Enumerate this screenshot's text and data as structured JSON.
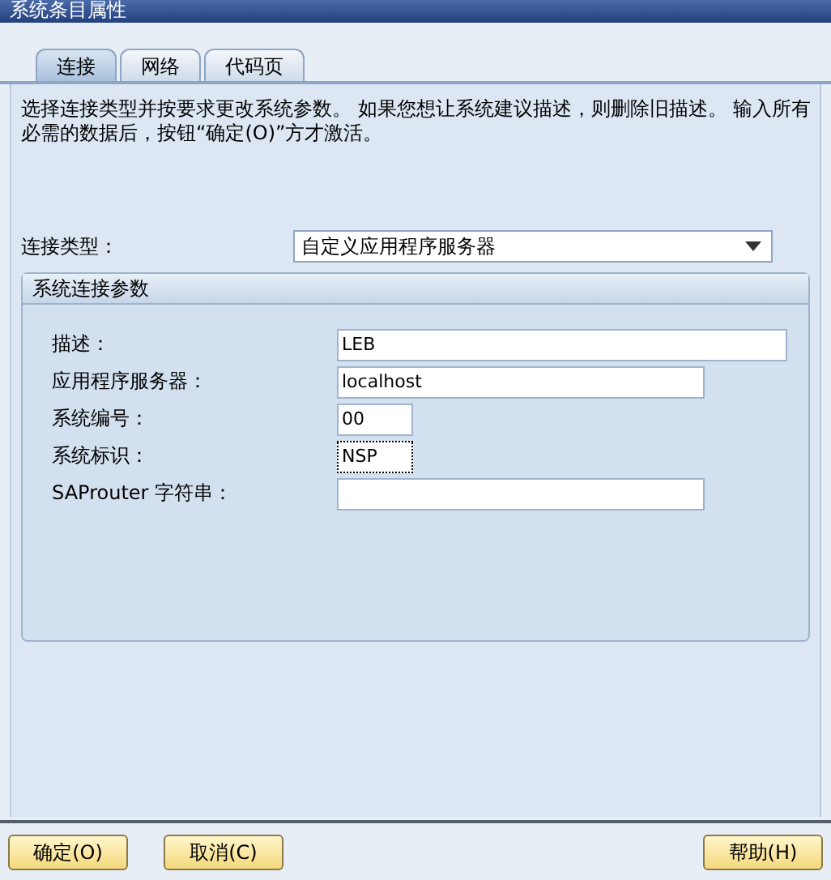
{
  "window": {
    "title": "系统条目属性"
  },
  "tabs": [
    {
      "label": "连接",
      "selected": true
    },
    {
      "label": "网络",
      "selected": false
    },
    {
      "label": "代码页",
      "selected": false
    }
  ],
  "instructions": "选择连接类型并按要求更改系统参数。 如果您想让系统建议描述，则删除旧描述。 输入所有必需的数据后，按钮“确定(O)”方才激活。",
  "connection_type": {
    "label": "连接类型：",
    "value": "自定义应用程序服务器"
  },
  "group": {
    "title": "系统连接参数",
    "fields": [
      {
        "label": "描述：",
        "value": "LEB",
        "focused": false
      },
      {
        "label": "应用程序服务器：",
        "value": "localhost",
        "focused": false
      },
      {
        "label": "系统编号：",
        "value": "00",
        "focused": false
      },
      {
        "label": "系统标识：",
        "value": "NSP",
        "focused": true
      },
      {
        "label": "SAProuter 字符串：",
        "focused": false
      }
    ]
  },
  "buttons": [
    {
      "label": "确定(O)"
    },
    {
      "label": "取消(C)"
    },
    {
      "label": "帮助(H)"
    }
  ]
}
